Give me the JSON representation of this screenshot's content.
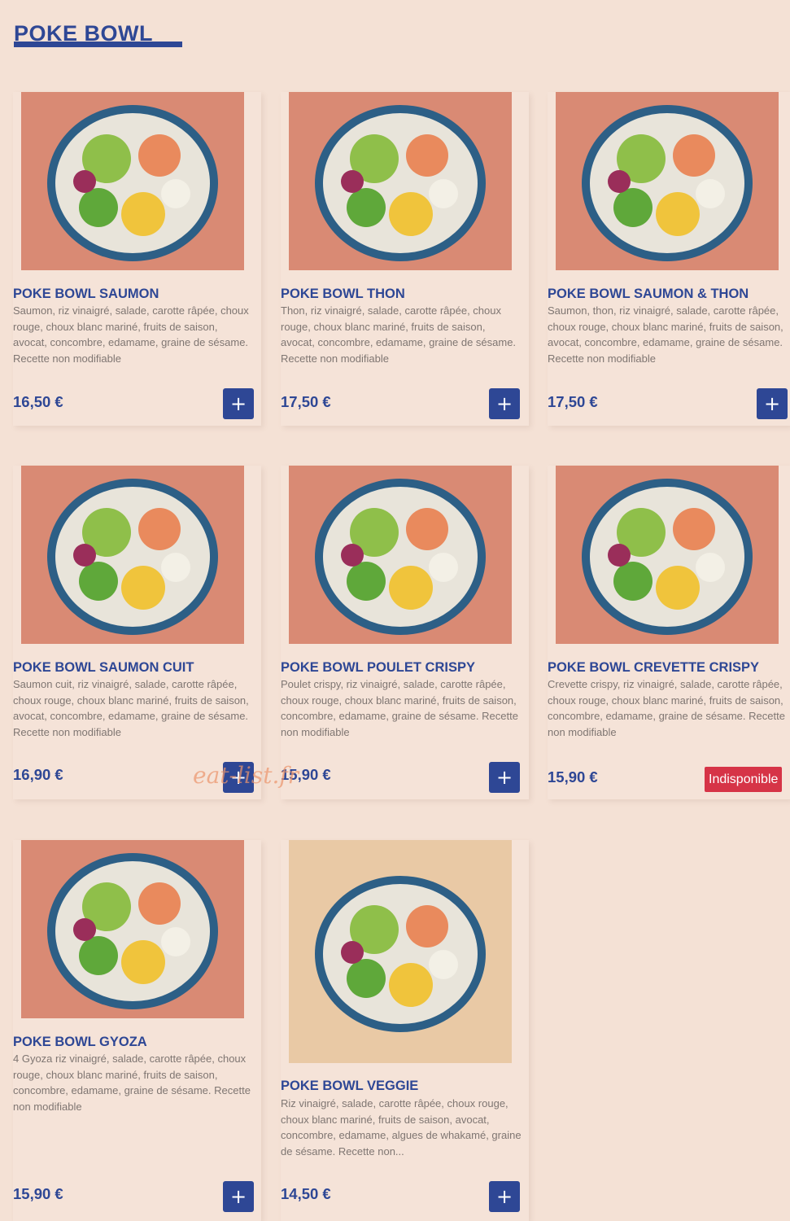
{
  "section": {
    "title": "POKE BOWL"
  },
  "colors": {
    "page_background": "#f4e1d5",
    "accent": "#2e4795",
    "unavailable": "#d63447",
    "image_background": "#d98a74"
  },
  "icons": {
    "add": "plus-icon"
  },
  "watermark": "eat-list.fr",
  "products": [
    {
      "name": "POKE BOWL SAUMON",
      "description": "Saumon, riz vinaigré, salade, carotte râpée, choux rouge, choux blanc mariné, fruits de saison, avocat, concombre, edamame, graine de sésame. Recette non modifiable",
      "price": "16,50 €",
      "action": "+"
    },
    {
      "name": "POKE BOWL THON",
      "description": "Thon, riz vinaigré, salade, carotte râpée, choux rouge, choux blanc mariné, fruits de saison, avocat, concombre, edamame, graine de sésame. Recette non modifiable",
      "price": "17,50 €",
      "action": "+"
    },
    {
      "name": "POKE BOWL SAUMON & THON",
      "description": "Saumon, thon, riz vinaigré, salade, carotte râpée, choux rouge, choux blanc mariné, fruits de saison, avocat, concombre, edamame, graine de sésame. Recette non modifiable",
      "price": "17,50 €",
      "action": "+"
    },
    {
      "name": "POKE BOWL SAUMON CUIT",
      "description": "Saumon cuit, riz vinaigré, salade, carotte râpée, choux rouge, choux blanc mariné, fruits de saison, avocat, concombre, edamame, graine de sésame. Recette non modifiable",
      "price": "16,90 €",
      "action": "+"
    },
    {
      "name": "POKE BOWL POULET CRISPY",
      "description": "Poulet crispy, riz vinaigré, salade, carotte râpée, choux rouge, choux blanc mariné, fruits de saison, concombre, edamame, graine de sésame. Recette non modifiable",
      "price": "15,90 €",
      "action": "+"
    },
    {
      "name": "POKE BOWL CREVETTE CRISPY",
      "description": "Crevette crispy, riz vinaigré, salade, carotte râpée, choux rouge, choux blanc mariné, fruits de saison, concombre, edamame, graine de sésame. Recette non modifiable",
      "price": "15,90 €",
      "status": "Indisponible"
    },
    {
      "name": "POKE BOWL GYOZA",
      "description": "4 Gyoza riz vinaigré, salade, carotte râpée, choux rouge, choux blanc mariné, fruits de saison, concombre, edamame, graine de sésame. Recette non modifiable",
      "price": "15,90 €",
      "action": "+"
    },
    {
      "name": "POKE BOWL VEGGIE",
      "description": "Riz vinaigré, salade, carotte râpée, choux rouge, choux blanc mariné, fruits de saison, avocat, concombre, edamame, algues de whakamé, graine de sésame. Recette non...",
      "price": "14,50 €",
      "action": "+"
    }
  ]
}
